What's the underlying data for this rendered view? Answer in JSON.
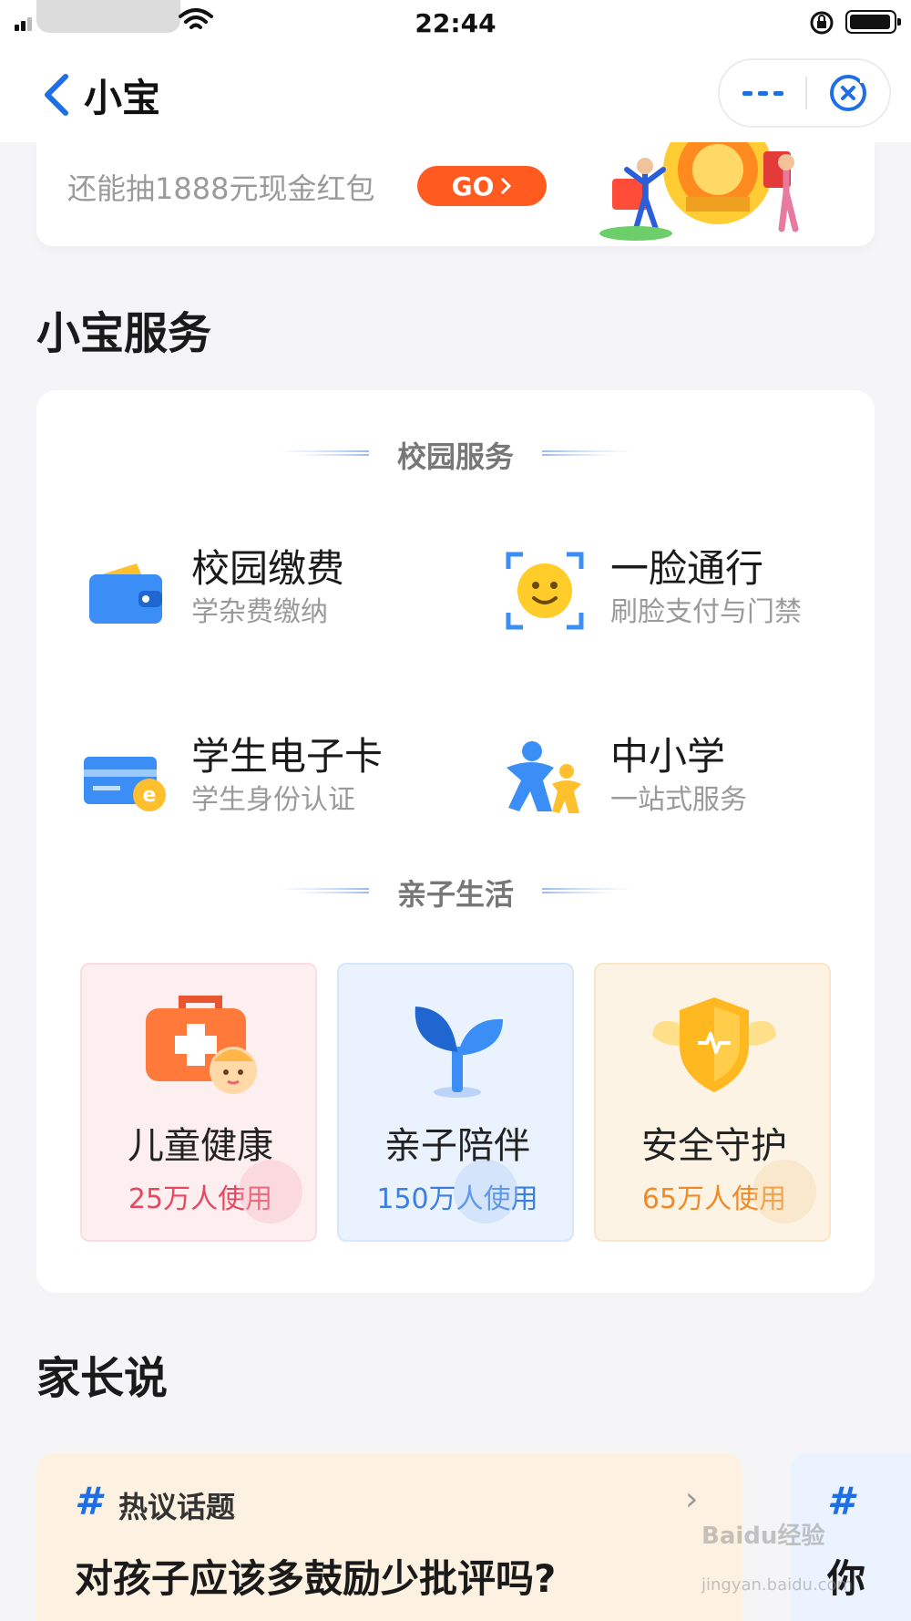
{
  "status_bar": {
    "time": "22:44"
  },
  "nav": {
    "title": "小宝"
  },
  "banner": {
    "subtitle": "还能抽1888元现金红包",
    "go_label": "GO"
  },
  "services_section": {
    "title": "小宝服务"
  },
  "campus": {
    "category": "校园服务",
    "items": [
      {
        "name": "校园缴费",
        "desc": "学杂费缴纳",
        "icon": "wallet-icon"
      },
      {
        "name": "一脸通行",
        "desc": "刷脸支付与门禁",
        "icon": "face-scan-icon"
      },
      {
        "name": "学生电子卡",
        "desc": "学生身份认证",
        "icon": "student-card-icon"
      },
      {
        "name": "中小学",
        "desc": "一站式服务",
        "icon": "kids-icon"
      }
    ]
  },
  "family": {
    "category": "亲子生活",
    "items": [
      {
        "name": "儿童健康",
        "count": "25万人使用",
        "icon": "medical-kit-icon",
        "color": "#e8475f",
        "bg": "#fdeef0"
      },
      {
        "name": "亲子陪伴",
        "count": "150万人使用",
        "icon": "sprout-icon",
        "color": "#3b7fe0",
        "bg": "#eaf2fd"
      },
      {
        "name": "安全守护",
        "count": "65万人使用",
        "icon": "shield-icon",
        "color": "#f08a24",
        "bg": "#fdf3e4"
      }
    ]
  },
  "parents_section": {
    "title": "家长说"
  },
  "topics": [
    {
      "tag": "热议话题",
      "question": "对孩子应该多鼓励少批评吗?"
    },
    {
      "question_peek": "你"
    }
  ],
  "watermark": {
    "line1": "Baidu经验",
    "line2": "jingyan.baidu.com"
  }
}
